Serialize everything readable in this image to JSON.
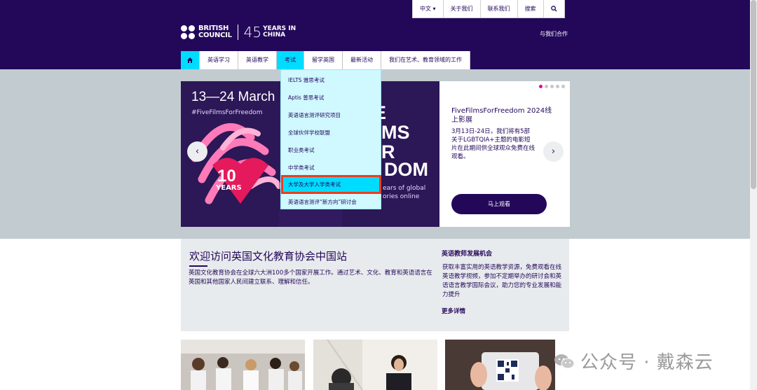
{
  "utility_bar": {
    "language": "中文 ▾",
    "about": "关于我们",
    "contact": "联系我们",
    "search": "搜索",
    "search_icon": "search-icon"
  },
  "logo": {
    "line1": "BRITISH",
    "line2": "COUNCIL",
    "big": "45",
    "years_line1": "YEARS IN",
    "years_line2": "CHINA"
  },
  "partner_link": "与我们合作",
  "nav": {
    "home_icon": "home-icon",
    "items": [
      {
        "label": "英语学习"
      },
      {
        "label": "英语教学"
      },
      {
        "label": "考试"
      },
      {
        "label": "留学英国"
      },
      {
        "label": "最新活动"
      },
      {
        "label": "我们在艺术、教育领域的工作"
      }
    ]
  },
  "dropdown": {
    "items": [
      "IELTS 雅思考试",
      "Aptis 普思考试",
      "英语语言测评研究项目",
      "全球伙伴学校联盟",
      "职业类考试",
      "中学类考试",
      "大学及大学入学类考试",
      "英语语言测评“新方向”研讨会"
    ]
  },
  "hero": {
    "date": "13—24 March",
    "hashtag": "#FiveFilmsForFreedom",
    "big_lines": [
      "E",
      "MS",
      "R",
      "DOM"
    ],
    "ten": "10",
    "years": "YEARS",
    "small_text_1": "ears of global",
    "small_text_2": "ories online",
    "panel_title": "FiveFilmsForFreedom 2024线上影展",
    "panel_desc": "3月13日-24日，我们将有5部关于LGBTQIA+主题的电影短片在此期间供全球观众免费在线观看。",
    "button": "马上观看",
    "prev_icon": "chevron-left-icon",
    "next_icon": "chevron-right-icon"
  },
  "welcome": {
    "title": "欢迎访问英国文化教育协会中国站",
    "text": "英国文化教育协会在全球六大洲100多个国家开展工作。通过艺术、文化、教育和英语语言在英国和其他国家人民间建立联系、理解和信任。",
    "teacher_title": "英语教师发展机会",
    "teacher_text": "获取丰富实用的英语教学资源，免费观看在线英语教学视频，参加不定期举办的研讨会和英语语言教学国际会议，助力您的专业发展和能力提升",
    "more": "更多详情"
  },
  "watermark": "公众号 · 戴森云",
  "colors": {
    "brand_purple": "#23085a",
    "accent_cyan": "#00dcff",
    "highlight_red": "#ea3e1f",
    "pink": "#e5009b"
  }
}
